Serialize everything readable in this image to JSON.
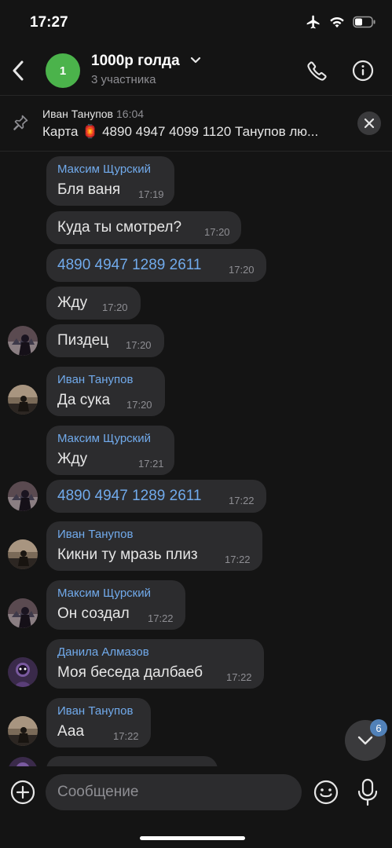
{
  "status_bar": {
    "time": "17:27"
  },
  "header": {
    "avatar_initial": "1",
    "title": "1000р голда",
    "subtitle": "3 участника",
    "avatar_color": "#4bb34b"
  },
  "pinned": {
    "author": "Иван Танупов",
    "time": "16:04",
    "text": "Карта 🏮 4890 4947 4099 1120 Танупов лю..."
  },
  "messages": [
    {
      "sender": "Максим Щурский",
      "text": "Бля ваня",
      "time": "17:19",
      "avatar": ""
    },
    {
      "sender": "",
      "text": "Куда ты смотрел?",
      "time": "17:20",
      "avatar": ""
    },
    {
      "sender": "",
      "text": "4890 4947 1289 2611",
      "time": "17:20",
      "avatar": "",
      "link": true
    },
    {
      "sender": "",
      "text": "Жду",
      "time": "17:20",
      "avatar": ""
    },
    {
      "sender": "",
      "text": "Пиздец",
      "time": "17:20",
      "avatar": "maxim"
    },
    {
      "sender": "Иван Танупов",
      "text": "Да сука",
      "time": "17:20",
      "avatar": "ivan"
    },
    {
      "sender": "Максим Щурский",
      "text": "Жду",
      "time": "17:21",
      "avatar": ""
    },
    {
      "sender": "",
      "text": "4890 4947 1289 2611",
      "time": "17:22",
      "avatar": "maxim",
      "link": true
    },
    {
      "sender": "Иван Танупов",
      "text": "Кикни ту мразь плиз",
      "time": "17:22",
      "avatar": "ivan"
    },
    {
      "sender": "Максим Щурский",
      "text": "Он создал",
      "time": "17:22",
      "avatar": "maxim"
    },
    {
      "sender": "Данила Алмазов",
      "text": "Моя беседа далбаеб",
      "time": "17:22",
      "avatar": "danila"
    },
    {
      "sender": "Иван Танупов",
      "text": "Ааа",
      "time": "17:22",
      "avatar": "ivan"
    }
  ],
  "unread_count": "6",
  "composer": {
    "placeholder": "Сообщение"
  },
  "colors": {
    "accent": "#71aaeb",
    "bubble": "#2c2c2e",
    "badge": "#5181b8",
    "background": "#141414"
  }
}
